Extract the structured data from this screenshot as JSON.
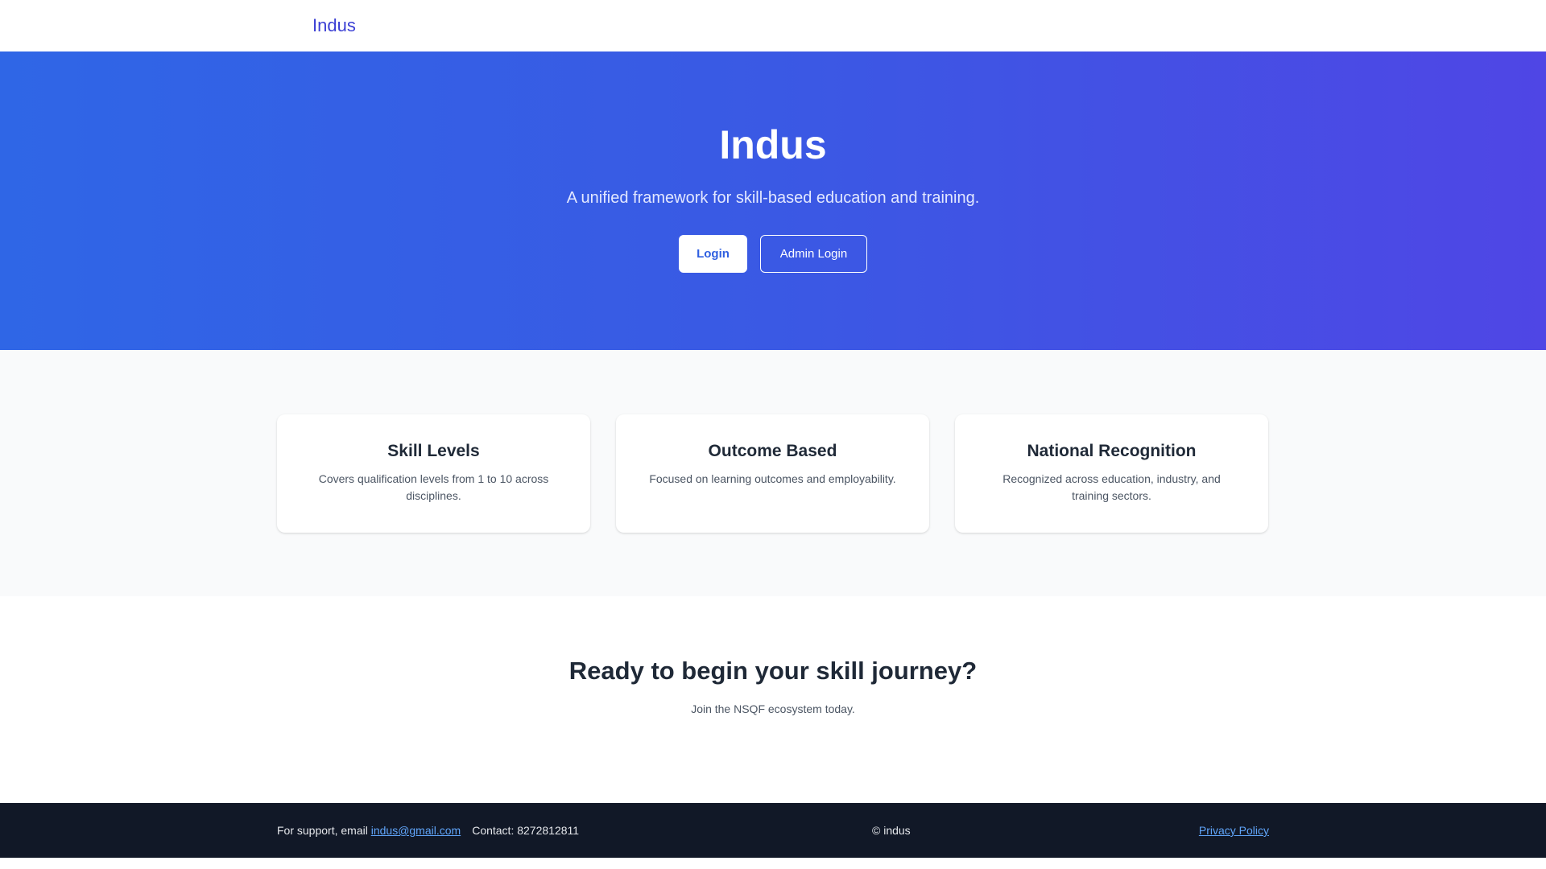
{
  "nav": {
    "brand": "Indus"
  },
  "hero": {
    "title": "Indus",
    "subtitle": "A unified framework for skill-based education and training.",
    "login_label": "Login",
    "admin_login_label": "Admin Login"
  },
  "features": [
    {
      "title": "Skill Levels",
      "text": "Covers qualification levels from 1 to 10 across disciplines."
    },
    {
      "title": "Outcome Based",
      "text": "Focused on learning outcomes and employability."
    },
    {
      "title": "National Recognition",
      "text": "Recognized across education, industry, and training sectors."
    }
  ],
  "cta": {
    "title": "Ready to begin your skill journey?",
    "subtitle": "Join the NSQF ecosystem today."
  },
  "footer": {
    "support_prefix": "For support, email ",
    "support_email": "indus@gmail.com",
    "contact": "Contact: 8272812811",
    "copyright": "© indus",
    "privacy_label": "Privacy Policy"
  },
  "colors": {
    "brand": "#3b3fd4",
    "hero_gradient_start": "#2f66e6",
    "hero_gradient_end": "#4f46e5",
    "footer_bg": "#111827",
    "link": "#60a5fa"
  }
}
